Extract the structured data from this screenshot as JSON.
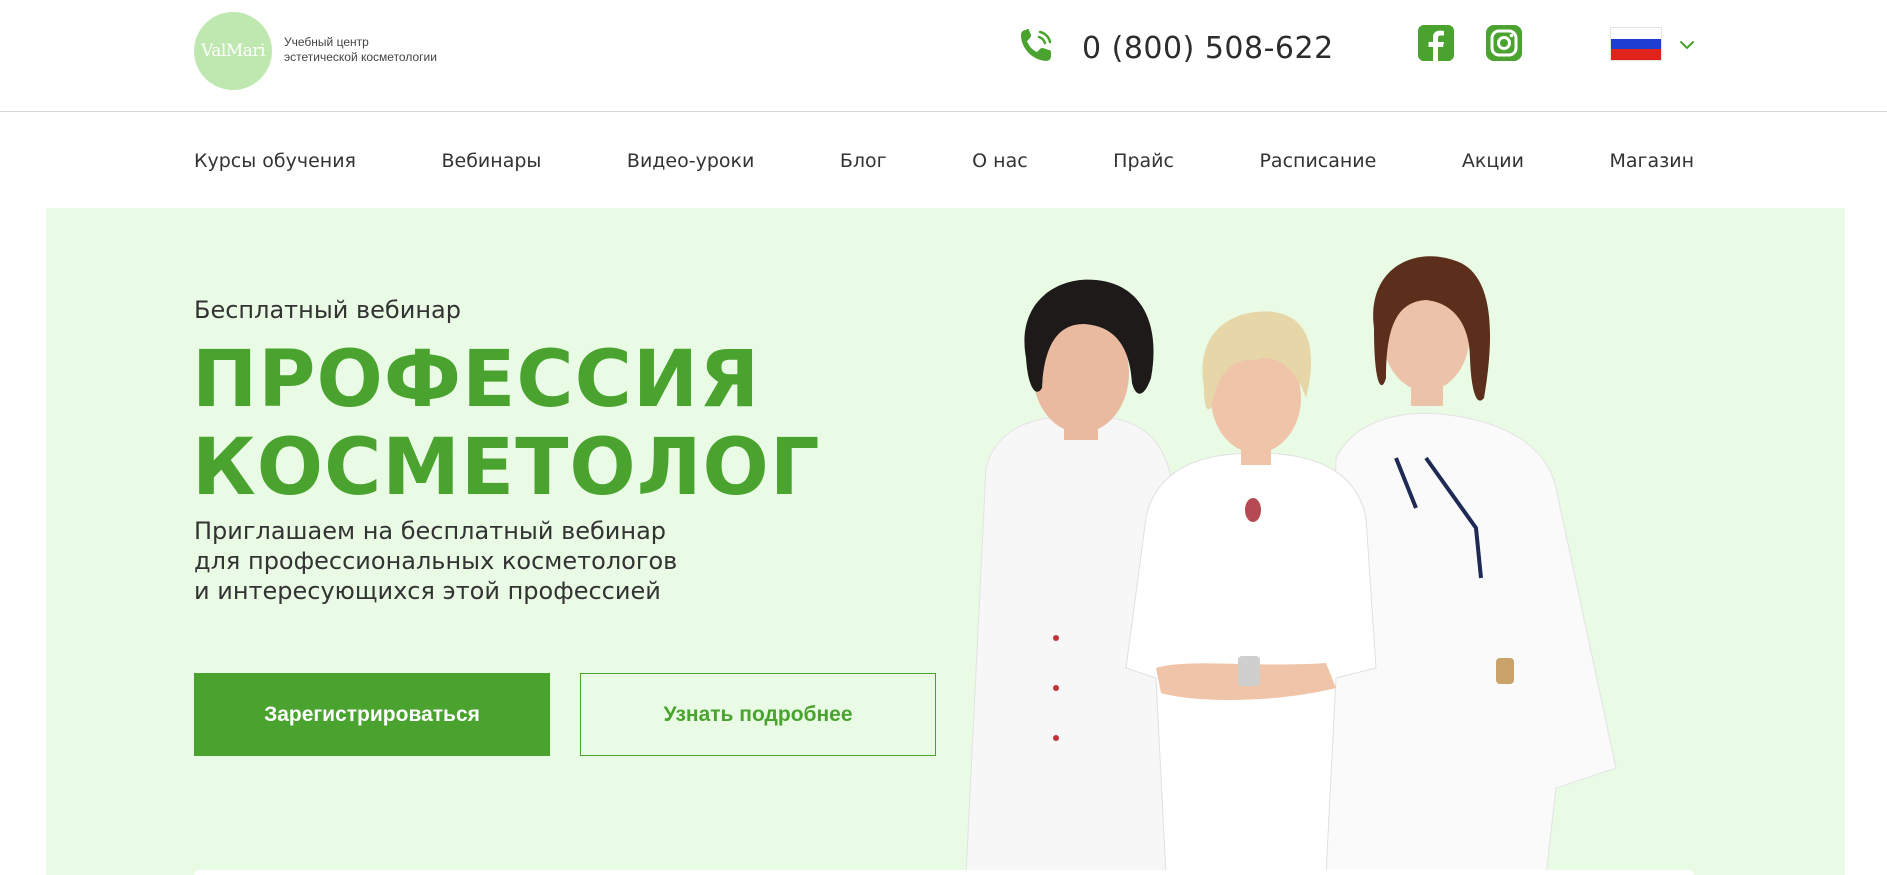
{
  "header": {
    "logo_text": "ValMari",
    "tagline_line1": "Учебный центр",
    "tagline_line2": "эстетической косметологии",
    "phone": "0 (800) 508-622",
    "language": "ru",
    "social": [
      "facebook-icon",
      "instagram-icon"
    ]
  },
  "nav": {
    "items": [
      "Курсы обучения",
      "Вебинары",
      "Видео-уроки",
      "Блог",
      "О нас",
      "Прайс",
      "Расписание",
      "Акции",
      "Магазин"
    ]
  },
  "hero": {
    "eyebrow": "Бесплатный вебинар",
    "title_line1": "ПРОФЕССИЯ",
    "title_line2": "КОСМЕТОЛОГ",
    "lead_line1": "Приглашаем на бесплатный вебинар",
    "lead_line2": "для профессиональных косметологов",
    "lead_line3": "и интересующихся этой профессией",
    "primary_button": "Зарегистрироваться",
    "secondary_button": "Узнать подробнее"
  },
  "colors": {
    "accent": "#4ba32f",
    "hero_bg": "#e9fbe5",
    "logo_bg": "#bfe8b0",
    "text": "#333333"
  }
}
